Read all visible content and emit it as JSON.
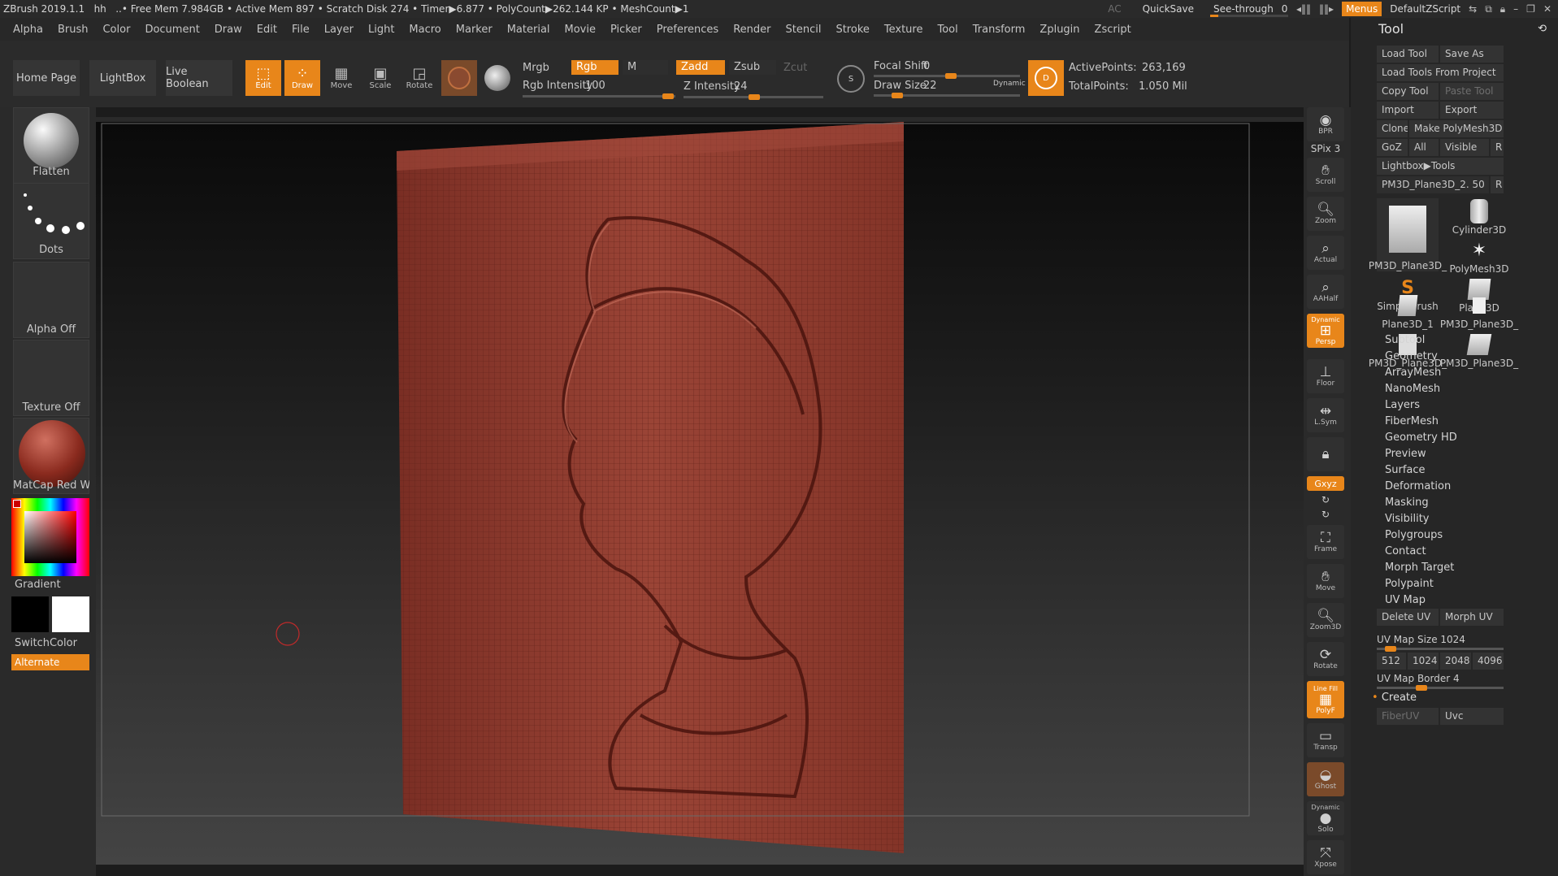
{
  "titlebar": {
    "app": "ZBrush 2019.1.1",
    "doc": "hh",
    "stats": "Free Mem 7.984GB • Active Mem 897 • Scratch Disk 274 •  Timer▶6.877 • PolyCount▶262.144 KP  • MeshCount▶1",
    "ac": "AC",
    "quicksave": "QuickSave",
    "see_through_label": "See-through",
    "see_through_value": "0",
    "see_through_fraction": 0,
    "menus": "Menus",
    "script": "DefaultZScript"
  },
  "menubar": [
    "Alpha",
    "Brush",
    "Color",
    "Document",
    "Draw",
    "Edit",
    "File",
    "Layer",
    "Light",
    "Macro",
    "Marker",
    "Material",
    "Movie",
    "Picker",
    "Preferences",
    "Render",
    "Stencil",
    "Stroke",
    "Texture",
    "Tool",
    "Transform",
    "Zplugin",
    "Zscript"
  ],
  "shelf": {
    "home": "Home Page",
    "lightbox": "LightBox",
    "live_boolean": "Live Boolean",
    "tools": [
      {
        "label": "Edit",
        "active": true
      },
      {
        "label": "Draw",
        "active": true
      },
      {
        "label": "Move",
        "active": false
      },
      {
        "label": "Scale",
        "active": false
      },
      {
        "label": "Rotate",
        "active": false
      }
    ],
    "mrgb": "Mrgb",
    "rgb": "Rgb",
    "m": "M",
    "zadd": "Zadd",
    "zsub": "Zsub",
    "zcut": "Zcut",
    "rgb_intensity_label": "Rgb Intensity",
    "rgb_intensity": "100",
    "z_intensity_label": "Z Intensity",
    "z_intensity": "24",
    "focal_shift_label": "Focal Shift",
    "focal_shift": "0",
    "draw_size_label": "Draw Size",
    "draw_size": "22",
    "dynamic": "Dynamic",
    "active_points_label": "ActivePoints:",
    "active_points": "263,169",
    "total_points_label": "TotalPoints:",
    "total_points": "1.050 Mil"
  },
  "lefttray": {
    "brush": "Flatten",
    "stroke": "Dots",
    "alpha": "Alpha Off",
    "texture": "Texture Off",
    "material": "MatCap Red Wax",
    "gradient": "Gradient",
    "switchcolor": "SwitchColor",
    "alternate": "Alternate"
  },
  "rightdock": {
    "bpr": "BPR",
    "spix": "SPix 3",
    "scroll": "Scroll",
    "zoom": "Zoom",
    "actual": "Actual",
    "aahalf": "AAHalf",
    "persp": "Persp",
    "persp_top": "Dynamic",
    "floor": "Floor",
    "lsym": "L.Sym",
    "xyz": "Gxyz",
    "frame": "Frame",
    "move": "Move",
    "zoom3d": "Zoom3D",
    "rotate": "Rotate",
    "polyf": "PolyF",
    "polyf_top": "Line Fill",
    "transp": "Transp",
    "ghost": "Ghost",
    "solo": "Solo",
    "solo_top": "Dynamic",
    "xpose": "Xpose"
  },
  "toolpanel": {
    "title": "Tool",
    "load_tool": "Load Tool",
    "save_as": "Save As",
    "load_from_project": "Load Tools From Project",
    "copy_tool": "Copy Tool",
    "paste_tool": "Paste Tool",
    "import": "Import",
    "export": "Export",
    "clone": "Clone",
    "make_polymesh": "Make PolyMesh3D",
    "goz": "GoZ",
    "all": "All",
    "visible": "Visible",
    "r": "R",
    "lightbox_tools": "Lightbox▶Tools",
    "current_tool": "PM3D_Plane3D_2. 50",
    "thumbs": [
      "PM3D_Plane3D_",
      "Cylinder3D",
      "PolyMesh3D",
      "SimpleBrush",
      "Plane3D",
      "Plane3D_1",
      "PM3D_Plane3D_",
      "PM3D_Plane3D_",
      "PM3D_Plane3D_"
    ],
    "subpalettes": [
      "Subtool",
      "Geometry",
      "ArrayMesh",
      "NanoMesh",
      "Layers",
      "FiberMesh",
      "Geometry HD",
      "Preview",
      "Surface",
      "Deformation",
      "Masking",
      "Visibility",
      "Polygroups",
      "Contact",
      "Morph Target",
      "Polypaint",
      "UV Map"
    ],
    "delete_uv": "Delete UV",
    "morph_uv": "Morph UV",
    "uv_map_size_label": "UV Map Size",
    "uv_map_size": "1024",
    "sizes": [
      "512",
      "1024",
      "2048",
      "4096"
    ],
    "uv_map_border_label": "UV Map Border",
    "uv_map_border": "4",
    "create": "Create",
    "fiberuv": "FiberUV",
    "uvc": "Uvc"
  },
  "colors": {
    "accent": "#e8861a",
    "mesh": "#8a3a2e"
  }
}
